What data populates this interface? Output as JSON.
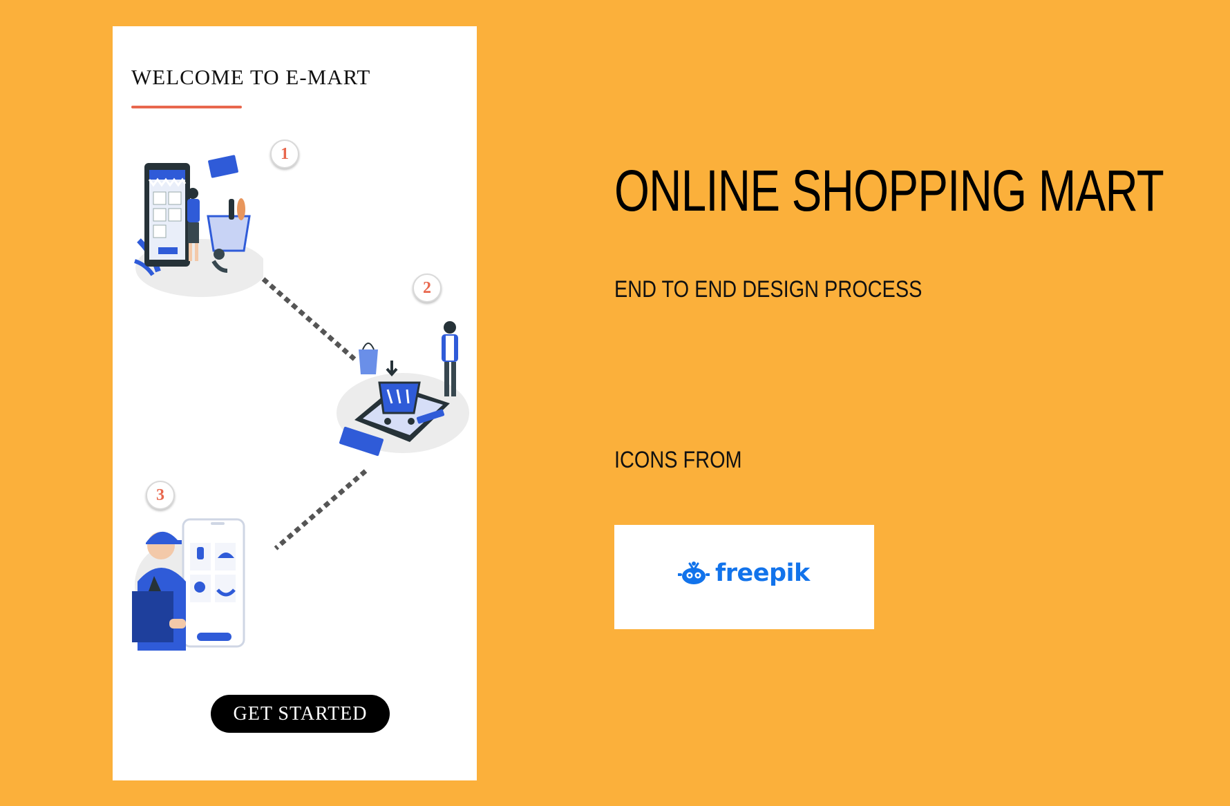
{
  "phone": {
    "heading": "WELCOME TO E-MART",
    "steps": [
      "1",
      "2",
      "3"
    ],
    "cta_label": "GET STARTED"
  },
  "side": {
    "title": "ONLINE SHOPPING MART",
    "subtitle": "END TO END DESIGN PROCESS",
    "icons_from": "ICONS FROM"
  },
  "brand": {
    "name": "freepik",
    "color": "#1273eb"
  },
  "colors": {
    "background": "#fbb03b",
    "accent": "#e8674d",
    "illustration_blue": "#2f5bd8",
    "dark": "#263238"
  },
  "icons": [
    "online-store-illustration",
    "shopping-cart-illustration",
    "delivery-man-illustration",
    "freepik-logo-icon"
  ]
}
